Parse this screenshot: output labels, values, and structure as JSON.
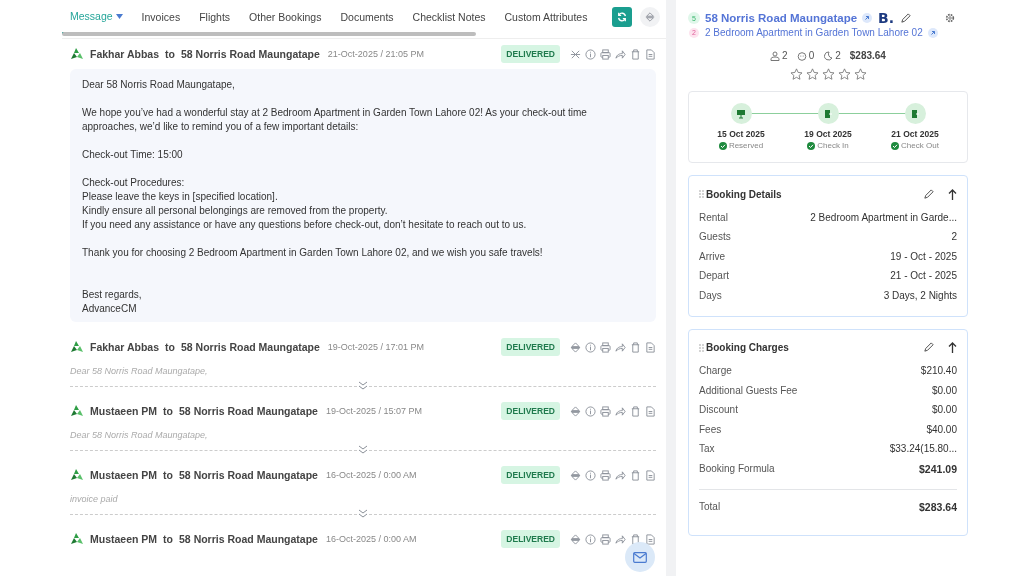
{
  "tabs": [
    {
      "label": "Message",
      "selected": true,
      "dropdown": true
    },
    {
      "label": "Invoices",
      "selected": false
    },
    {
      "label": "Flights",
      "selected": false
    },
    {
      "label": "Other Bookings",
      "selected": false
    },
    {
      "label": "Documents",
      "selected": false
    },
    {
      "label": "Checklist Notes",
      "selected": false
    },
    {
      "label": "Custom Attributes",
      "selected": false
    }
  ],
  "messages": [
    {
      "sender": "Fakhar Abbas",
      "connector": "to",
      "recipient": "58 Norris Road Maungatape",
      "timestamp": "21-Oct-2025 / 21:05 PM",
      "status": "DELIVERED",
      "expanded": true,
      "body": [
        {
          "kind": "paragraph",
          "lines": [
            "Dear 58 Norris Road Maungatape,"
          ]
        },
        {
          "kind": "paragraph",
          "lines": [
            "We hope you’ve had a wonderful stay at 2 Bedroom Apartment in Garden Town Lahore 02! As your check-out time approaches, we’d like to remind you of a few important details:"
          ]
        },
        {
          "kind": "paragraph",
          "lines": [
            "Check-out Time: 15:00"
          ]
        },
        {
          "kind": "paragraph",
          "lines": [
            "Check-out Procedures:",
            "Please leave the keys in [specified location].",
            "Kindly ensure all personal belongings are removed from the property.",
            "If you need any assistance or have any questions before check-out, don’t hesitate to reach out to us."
          ]
        },
        {
          "kind": "paragraph",
          "lines": [
            "Thank you for choosing 2 Bedroom Apartment in Garden Town Lahore 02, and we wish you safe travels!"
          ]
        },
        {
          "kind": "signature",
          "lines": [
            "Best regards,",
            "AdvanceCM"
          ]
        }
      ]
    },
    {
      "sender": "Fakhar Abbas",
      "connector": "to",
      "recipient": "58 Norris Road Maungatape",
      "timestamp": "19-Oct-2025 / 17:01 PM",
      "status": "DELIVERED",
      "expanded": false,
      "preview": "Dear 58 Norris Road Maungatape,"
    },
    {
      "sender": "Mustaeen PM",
      "connector": "to",
      "recipient": "58 Norris Road Maungatape",
      "timestamp": "19-Oct-2025 / 15:07 PM",
      "status": "DELIVERED",
      "expanded": false,
      "preview": "Dear 58 Norris Road Maungatape,"
    },
    {
      "sender": "Mustaeen PM",
      "connector": "to",
      "recipient": "58 Norris Road Maungatape",
      "timestamp": "16-Oct-2025 / 0:00 AM",
      "status": "DELIVERED",
      "expanded": false,
      "preview": "invoice paid"
    },
    {
      "sender": "Mustaeen PM",
      "connector": "to",
      "recipient": "58 Norris Road Maungatape",
      "timestamp": "16-Oct-2025 / 0:00 AM",
      "status": "DELIVERED",
      "expanded": false
    }
  ],
  "guest": {
    "count_badge": "5",
    "name": "58 Norris Road Maungatape",
    "channel_logo": "B.",
    "rental_badge": "2",
    "rental": "2 Bedroom Apartment in Garden Town Lahore 02",
    "guests": "2",
    "pets": "0",
    "nights": "2",
    "amount": "$283.64",
    "stars": 0
  },
  "timeline": [
    {
      "date": "15 Oct 2025",
      "label": "Reserved",
      "kind": "reserved",
      "done": true
    },
    {
      "date": "19 Oct 2025",
      "label": "Check In",
      "kind": "checkin",
      "done": true
    },
    {
      "date": "21 Oct 2025",
      "label": "Check Out",
      "kind": "checkout",
      "done": true
    }
  ],
  "cards": [
    {
      "title": "Booking Details",
      "rows": [
        {
          "label": "Rental",
          "value": "2 Bedroom Apartment in Garde..."
        },
        {
          "label": "Guests",
          "value": "2"
        },
        {
          "label": "Arrive",
          "value": "19 - Oct - 2025"
        },
        {
          "label": "Depart",
          "value": "21 - Oct - 2025"
        },
        {
          "label": "Days",
          "value": "3 Days, 2 Nights"
        }
      ]
    },
    {
      "title": "Booking Charges",
      "rows": [
        {
          "label": "Charge",
          "value": "$210.40"
        },
        {
          "label": "Additional Guests Fee",
          "value": "$0.00"
        },
        {
          "label": "Discount",
          "value": "$0.00"
        },
        {
          "label": "Fees",
          "value": "$40.00"
        },
        {
          "label": "Tax",
          "value": "$33.24(15.80..."
        },
        {
          "label": "Booking Formula",
          "value": "$241.09",
          "bold": true
        }
      ],
      "total": {
        "label": "Total",
        "value": "$283.64"
      }
    }
  ]
}
